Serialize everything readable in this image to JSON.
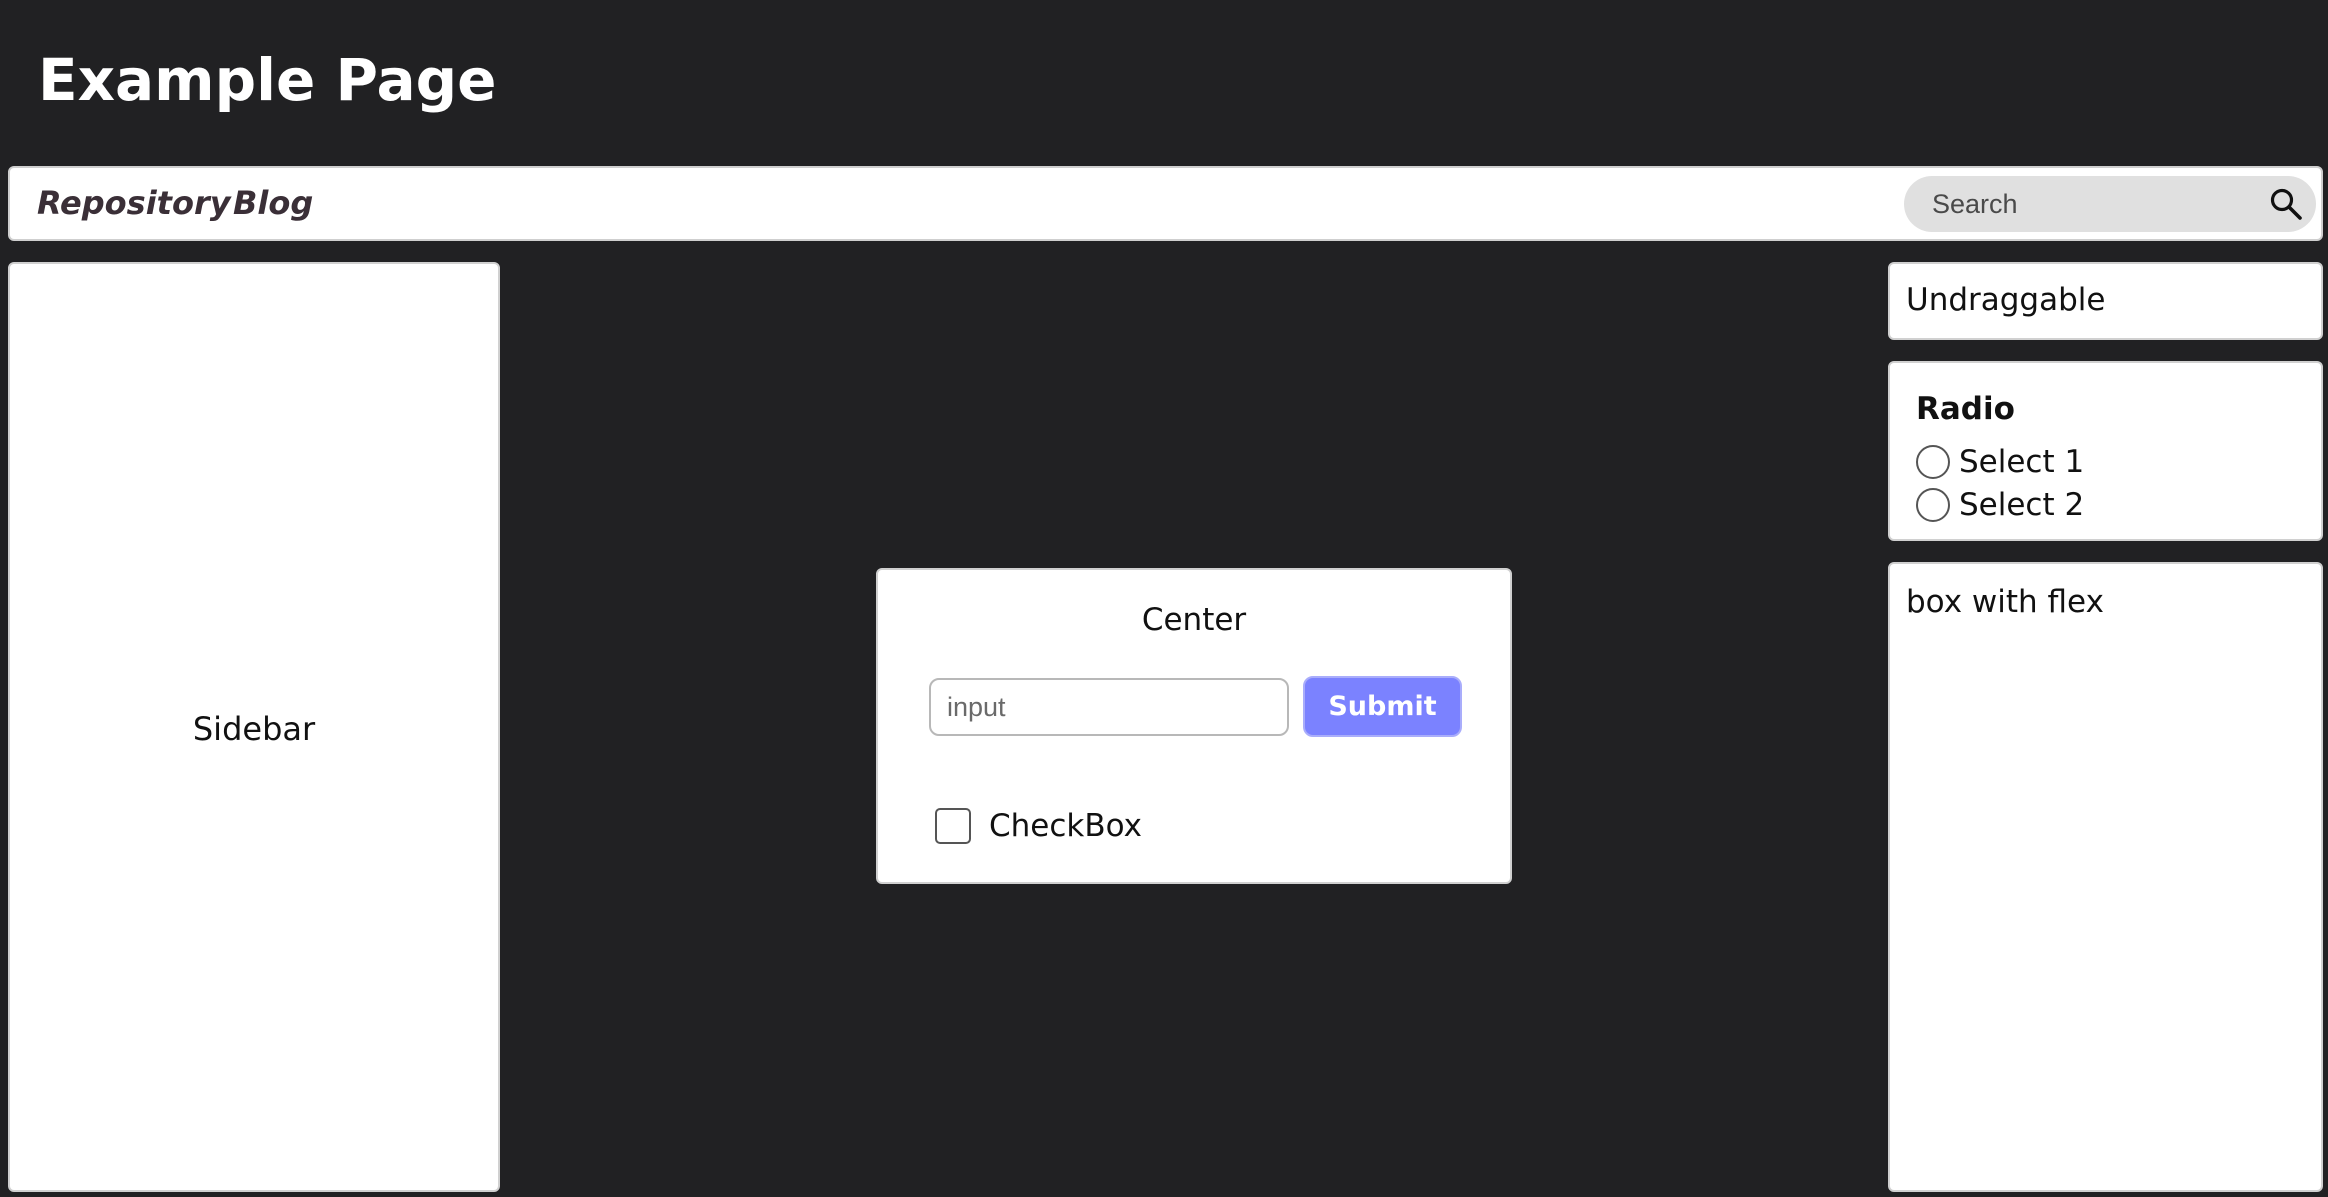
{
  "header": {
    "title": "Example Page"
  },
  "nav": {
    "links": [
      {
        "label": "Repository"
      },
      {
        "label": "Blog"
      }
    ],
    "search": {
      "placeholder": "Search",
      "icon": "search-icon"
    }
  },
  "sidebar": {
    "label": "Sidebar"
  },
  "center": {
    "title": "Center",
    "input_placeholder": "input",
    "input_value": "",
    "submit_label": "Submit",
    "submit_color": "#7b82ff",
    "checkbox_label": "CheckBox",
    "checkbox_checked": false
  },
  "right": {
    "undraggable_label": "Undraggable",
    "radio": {
      "title": "Radio",
      "options": [
        {
          "label": "Select 1",
          "selected": false
        },
        {
          "label": "Select 2",
          "selected": false
        }
      ]
    },
    "flex_box_label": "box with flex"
  },
  "colors": {
    "background": "#212123",
    "panel": "#ffffff",
    "nav_link": "#3a2f37",
    "search_bg": "#e0e0e0"
  }
}
